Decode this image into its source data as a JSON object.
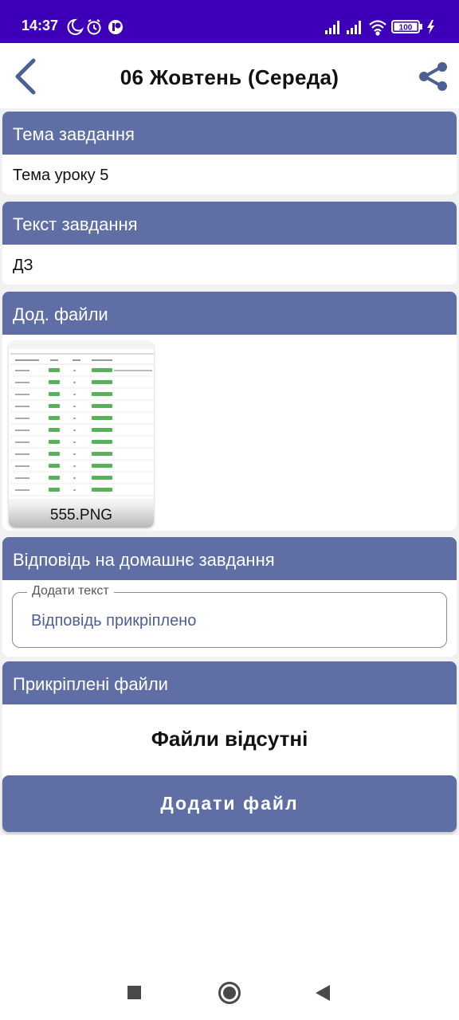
{
  "status_bar": {
    "time": "14:37",
    "battery": "100",
    "icons_left": [
      "moon-icon",
      "alarm-icon",
      "app-notification-icon"
    ],
    "icons_right": [
      "signal-icon",
      "signal-icon",
      "wifi-icon",
      "battery-icon",
      "charging-icon"
    ]
  },
  "app_bar": {
    "title": "06 Жовтень (Середа)"
  },
  "sections": {
    "topic": {
      "header": "Тема завдання",
      "value": "Тема уроку 5"
    },
    "task_text": {
      "header": "Текст завдання",
      "value": "ДЗ"
    },
    "extra_files": {
      "header": "Дод. файли",
      "file_name": "555.PNG"
    },
    "homework_answer": {
      "header": "Відповідь на домашнє завдання",
      "field_label": "Додати текст",
      "field_value": "Відповідь прикріплено"
    },
    "attached_files": {
      "header": "Прикріплені файли",
      "empty_text": "Файли відсутні"
    }
  },
  "add_file_button": "Додати файл",
  "colors": {
    "status_bar": "#3d00b8",
    "header_bar": "#5f6fa5",
    "accent_text": "#4c5f94"
  }
}
